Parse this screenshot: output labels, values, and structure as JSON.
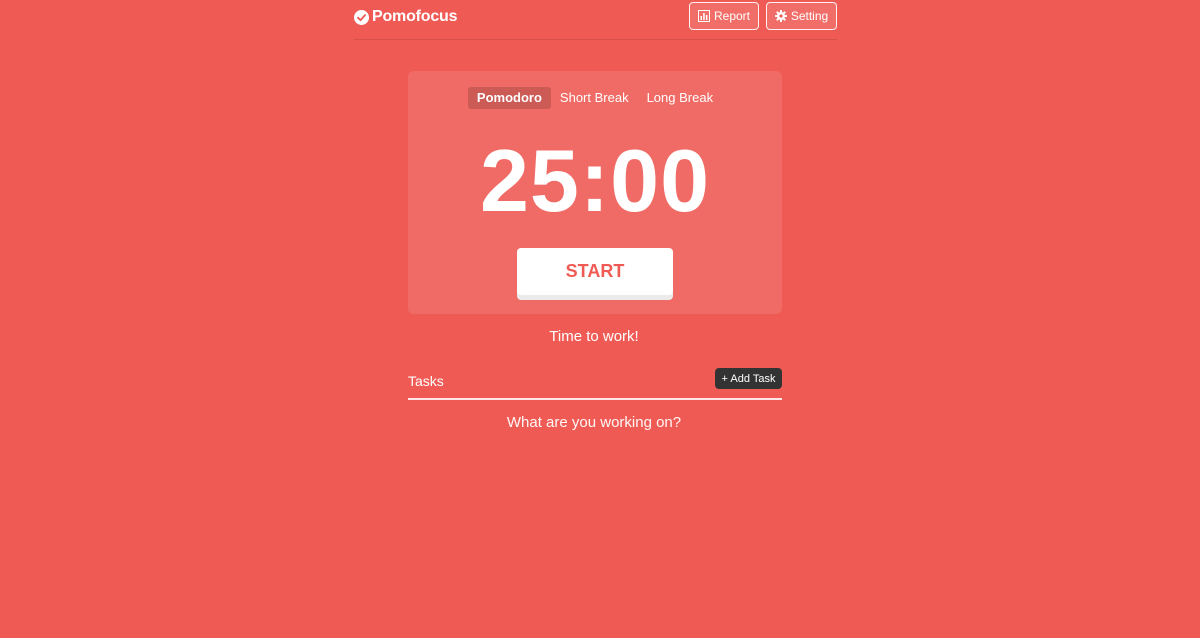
{
  "header": {
    "app_name": "Pomofocus",
    "report_label": "Report",
    "setting_label": "Setting"
  },
  "timer": {
    "modes": [
      "Pomodoro",
      "Short Break",
      "Long Break"
    ],
    "active_mode": "Pomodoro",
    "time": "25:00",
    "start_label": "START"
  },
  "status": "Time to work!",
  "tasks": {
    "title": "Tasks",
    "add_label": "+ Add Task",
    "prompt": "What are you working on?"
  },
  "colors": {
    "background": "#ef5b54",
    "start_text": "#ef5b54",
    "add_task_bg": "#333333"
  },
  "icons": {
    "logo": "check-circle-icon",
    "report": "bar-chart-icon",
    "setting": "gear-icon"
  }
}
